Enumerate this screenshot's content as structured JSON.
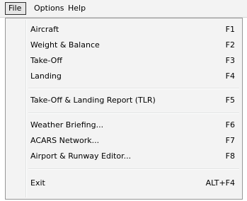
{
  "menubar": {
    "items": [
      {
        "label": "File",
        "underline": "F"
      },
      {
        "label": "Options",
        "underline": "O"
      },
      {
        "label": "Help",
        "underline": "H"
      }
    ]
  },
  "file_menu": {
    "items": [
      {
        "label": "Aircraft",
        "shortcut": "F1"
      },
      {
        "label": "Weight & Balance",
        "shortcut": "F2"
      },
      {
        "label": "Take-Off",
        "shortcut": "F3"
      },
      {
        "label": "Landing",
        "shortcut": "F4"
      },
      {
        "label": "Take-Off & Landing Report (TLR)",
        "shortcut": "F5"
      },
      {
        "label": "Weather Briefing...",
        "shortcut": "F6"
      },
      {
        "label": "ACARS Network...",
        "shortcut": "F7"
      },
      {
        "label": "Airport & Runway Editor...",
        "shortcut": "F8"
      },
      {
        "label": "Exit",
        "shortcut": "ALT+F4"
      }
    ]
  }
}
